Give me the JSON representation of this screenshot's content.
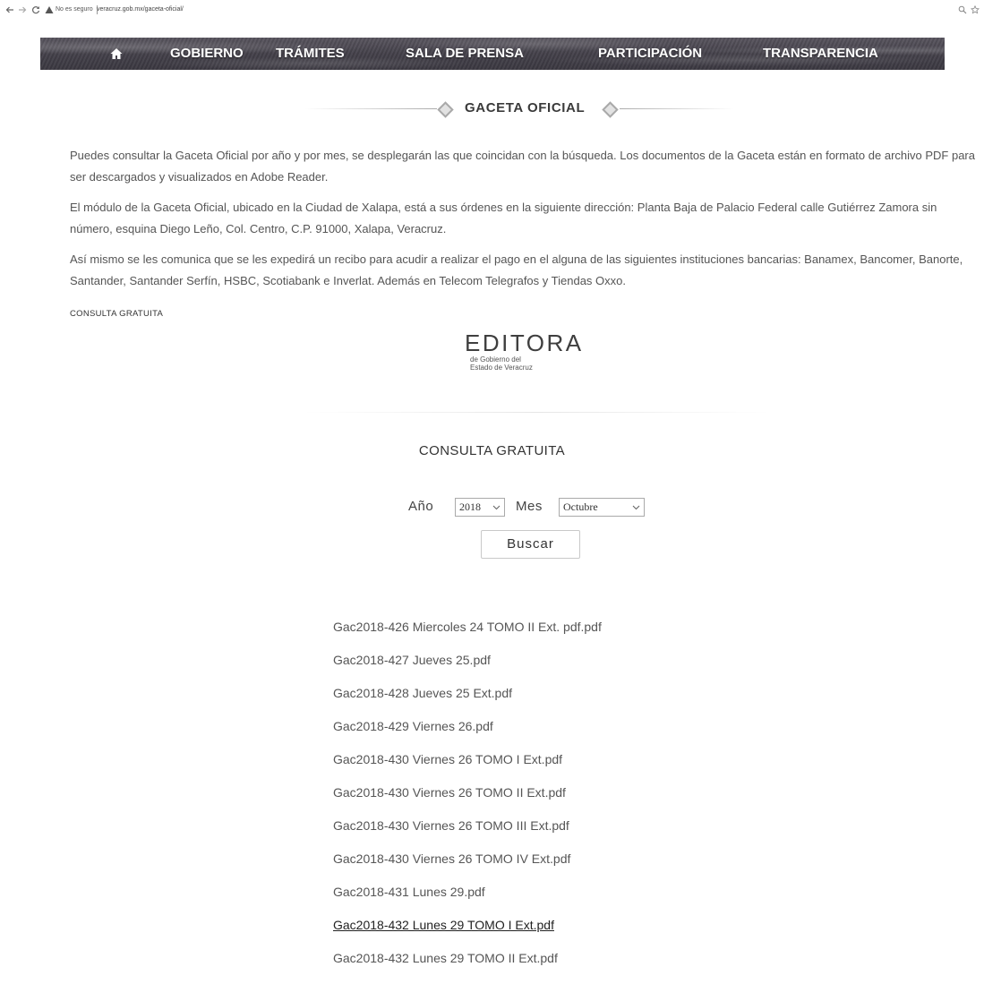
{
  "browser": {
    "security_label": "No es seguro",
    "url": "veracruz.gob.mx/gaceta-oficial/",
    "icons": [
      "back-arrow-icon",
      "forward-arrow-icon",
      "reload-icon",
      "warning-icon",
      "zoom-icon",
      "star-icon"
    ]
  },
  "nav": {
    "home_icon": "home-icon",
    "items": [
      "GOBIERNO",
      "TRÁMITES",
      "SALA DE PRENSA",
      "PARTICIPACIÓN",
      "TRANSPARENCIA"
    ]
  },
  "content": {
    "title": "GACETA OFICIAL",
    "paragraphs": [
      "Puedes consultar la Gaceta Oficial por año y por mes, se desplegarán las que coincidan con la búsqueda. Los documentos de la Gaceta están en formato de archivo PDF para ser descargados y visualizados en Adobe Reader.",
      "El módulo de la Gaceta Oficial, ubicado en la Ciudad de Xalapa, está a sus órdenes en la siguiente dirección: Planta Baja de Palacio Federal calle Gutiérrez Zamora sin número, esquina Diego Leño, Col. Centro, C.P. 91000, Xalapa, Veracruz.",
      "Así mismo se les comunica que se les expedirá un recibo para acudir a realizar el pago en el alguna de las siguientes instituciones bancarias: Banamex, Bancomer, Banorte, Santander, Santander Serfín, HSBC, Scotiabank e Inverlat. Además en Telecom Telegrafos y Tiendas Oxxo."
    ],
    "small_label": "CONSULTA GRATUITA"
  },
  "logo": {
    "wordmark": "EDITORA",
    "line1": "de Gobierno del",
    "line2": "Estado de Veracruz"
  },
  "search": {
    "heading": "CONSULTA GRATUITA",
    "year_label": "Año",
    "year_value": "2018",
    "month_label": "Mes",
    "month_value": "Octubre",
    "button_label": "Buscar"
  },
  "results": [
    "Gac2018-426 Miercoles 24 TOMO II Ext. pdf.pdf",
    "Gac2018-427 Jueves 25.pdf",
    "Gac2018-428 Jueves 25 Ext.pdf",
    "Gac2018-429 Viernes 26.pdf",
    "Gac2018-430 Viernes 26 TOMO I Ext.pdf",
    "Gac2018-430 Viernes 26 TOMO II Ext.pdf",
    "Gac2018-430 Viernes 26 TOMO III Ext.pdf",
    "Gac2018-430 Viernes 26 TOMO IV Ext.pdf",
    "Gac2018-431 Lunes 29.pdf",
    "Gac2018-432 Lunes 29 TOMO I Ext.pdf",
    "Gac2018-432 Lunes 29 TOMO II Ext.pdf"
  ],
  "colors": {
    "nav_background": "#47444d",
    "nav_text": "#ffffff",
    "body_text": "#555555",
    "link": "#555555",
    "link_hover": "#222222"
  }
}
